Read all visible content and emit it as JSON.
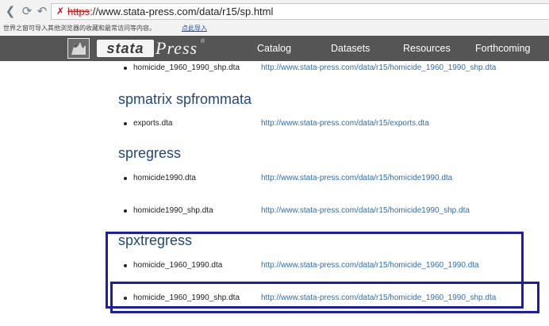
{
  "browser": {
    "address": {
      "protocol": "https",
      "rest": "://www.stata-press.com/data/r15/sp.html"
    },
    "infobar": {
      "message": "世界之窗可导入其他浏览器的收藏和最常访问等内容。",
      "link": "点此导入"
    }
  },
  "site": {
    "logo": {
      "stata": "stata",
      "press": "Press",
      "reg": "®"
    },
    "nav": [
      "Catalog",
      "Datasets",
      "Resources",
      "Forthcoming"
    ]
  },
  "content": {
    "top_item": {
      "file": "homicide_1960_1990_shp.dta",
      "link": "http://www.stata-press.com/data/r15/homicide_1960_1990_shp.dta"
    },
    "sections": [
      {
        "title": "spmatrix spfrommata",
        "items": [
          {
            "file": "exports.dta",
            "link": "http://www.stata-press.com/data/r15/exports.dta"
          }
        ]
      },
      {
        "title": "spregress",
        "items": [
          {
            "file": "homicide1990.dta",
            "link": "http://www.stata-press.com/data/r15/homicide1990.dta"
          },
          {
            "file": "homicide1990_shp.dta",
            "link": "http://www.stata-press.com/data/r15/homicide1990_shp.dta"
          }
        ]
      },
      {
        "title": "spxtregress",
        "items": [
          {
            "file": "homicide_1960_1990.dta",
            "link": "http://www.stata-press.com/data/r15/homicide_1960_1990.dta"
          },
          {
            "file": "homicide_1960_1990_shp.dta",
            "link": "http://www.stata-press.com/data/r15/homicide_1960_1990_shp.dta"
          }
        ]
      }
    ]
  },
  "colors": {
    "header_bg": "#555555",
    "section_title": "#204a77",
    "link": "#2f6fa8",
    "highlight_box": "#1d1da8"
  }
}
